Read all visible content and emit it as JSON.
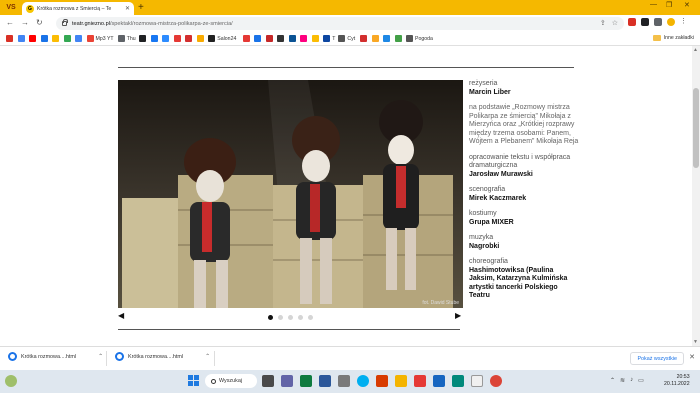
{
  "browser": {
    "tab": {
      "title": "Krótka rozmowa z Śmiercią – Te"
    },
    "new_tab": "+",
    "address": {
      "host": "teatr.gniezno.pl",
      "path": "/spektakl/rozmowa-mistrza-polikarpa-ze-smiercia/"
    },
    "bookmarks": [
      {
        "label": "",
        "color": "#d93025"
      },
      {
        "label": "",
        "color": "#4285f4"
      },
      {
        "label": "",
        "color": "#ff0000"
      },
      {
        "label": "",
        "color": "#1a73e8"
      },
      {
        "label": "",
        "color": "#fbbc04"
      },
      {
        "label": "",
        "color": "#34a853"
      },
      {
        "label": "",
        "color": "#4285f4"
      },
      {
        "label": "Mp3 YT",
        "color": "#ea4335"
      },
      {
        "label": "Thu",
        "color": "#5f6368"
      },
      {
        "label": "",
        "color": "#202124"
      },
      {
        "label": "",
        "color": "#1877f2"
      },
      {
        "label": "",
        "color": "#2d8cff"
      },
      {
        "label": "",
        "color": "#e53935"
      },
      {
        "label": "",
        "color": "#d32f2f"
      },
      {
        "label": "",
        "color": "#f9ab00"
      },
      {
        "label": "Salon24",
        "color": "#222222"
      },
      {
        "label": "",
        "color": "#e53935"
      },
      {
        "label": "",
        "color": "#1a73e8"
      },
      {
        "label": "",
        "color": "#c62828"
      },
      {
        "label": "",
        "color": "#333333"
      },
      {
        "label": "",
        "color": "#0b5394"
      },
      {
        "label": "",
        "color": "#ff007f"
      },
      {
        "label": "",
        "color": "#fbbc04"
      },
      {
        "label": "T",
        "color": "#0d47a1"
      },
      {
        "label": "Cyt",
        "color": "#555555"
      },
      {
        "label": "",
        "color": "#d32f2f"
      },
      {
        "label": "",
        "color": "#f9a825"
      },
      {
        "label": "",
        "color": "#1e88e5"
      },
      {
        "label": "",
        "color": "#43a047"
      },
      {
        "label": "Pogoda",
        "color": "#555555"
      }
    ],
    "other_bookmarks": "Inne zakładki"
  },
  "page": {
    "photo_credit": "fot. Dawid Stube",
    "carousel_prev": "◀",
    "carousel_next": "▶",
    "slides": 5,
    "active_slide": 1,
    "credits": [
      {
        "role": "reżyseria",
        "name": "Marcin Liber"
      },
      {
        "role": "",
        "text": "na podstawie „Rozmowy mistrza Polikarpa ze śmiercią” Mikołaja z Mierzyńca oraz „Krótkiej rozprawy między trzema osobami: Panem, Wójtem a Plebanem” Mikołaja Reja"
      },
      {
        "role": "opracowanie tekstu i współpraca dramaturgiczna",
        "name": "Jarosław Murawski"
      },
      {
        "role": "scenografia",
        "name": "Mirek Kaczmarek"
      },
      {
        "role": "kostiumy",
        "name": "Grupa MIXER"
      },
      {
        "role": "muzyka",
        "name": "Nagrobki"
      },
      {
        "role": "choreografia",
        "name": "Hashimotowiksa (Paulina Jaksim, Katarzyna Kulmińska artystki tancerki Polskiego Teatru"
      }
    ]
  },
  "downloads": {
    "items": [
      {
        "name": "Krótka rozmowa....html"
      },
      {
        "name": "Krótka rozmowa....html"
      }
    ],
    "show_all": "Pokaż wszystkie",
    "close": "✕"
  },
  "taskbar": {
    "search_label": "Wyszukaj",
    "time": "20:53",
    "date": "20.11.2022"
  }
}
